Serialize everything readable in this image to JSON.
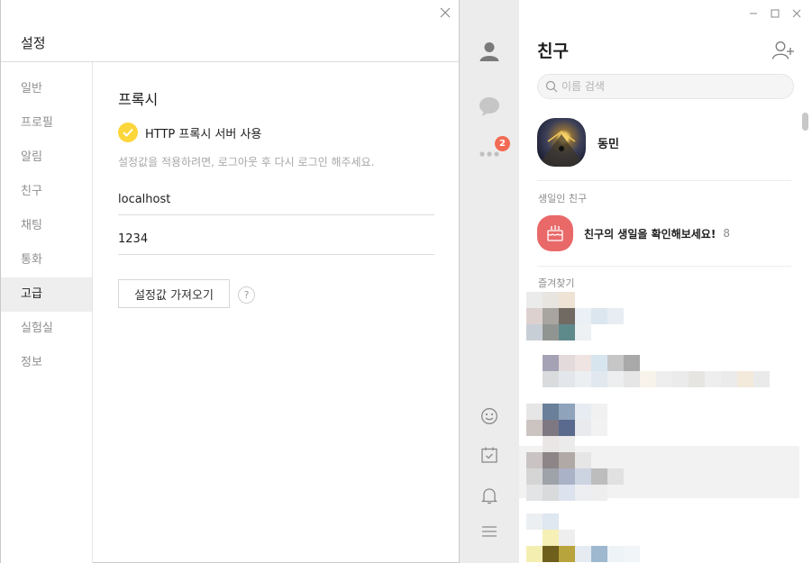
{
  "settings": {
    "title": "설정",
    "nav": [
      "일반",
      "프로필",
      "알림",
      "친구",
      "채팅",
      "통화",
      "고급",
      "실험실",
      "정보"
    ],
    "active_nav_index": 6,
    "proxy": {
      "section_title": "프록시",
      "checkbox_label": "HTTP 프록시 서버 사용",
      "checked": true,
      "hint": "설정값을 적용하려면, 로그아웃 후 다시 로그인 해주세요.",
      "host_value": "localhost",
      "port_value": "1234",
      "import_button": "설정값 가져오기",
      "help_label": "?"
    }
  },
  "sidebar": {
    "badge_count": "2",
    "icons": [
      "person-icon",
      "chat-bubble-icon",
      "more-icon",
      "emoji-icon",
      "calendar-icon",
      "bell-icon",
      "menu-icon"
    ]
  },
  "friends": {
    "title": "친구",
    "search_placeholder": "이름 검색",
    "me": {
      "name": "동민"
    },
    "birthday_section": "생일인 친구",
    "birthday_text": "친구의 생일을 확인해보세요!",
    "birthday_count": "8",
    "favorites_section": "즐겨찾기"
  },
  "colors": {
    "accent_yellow": "#fcd63a",
    "badge_red": "#f36b55",
    "birthday_red": "#e96969",
    "strip_gray": "#ececec"
  }
}
